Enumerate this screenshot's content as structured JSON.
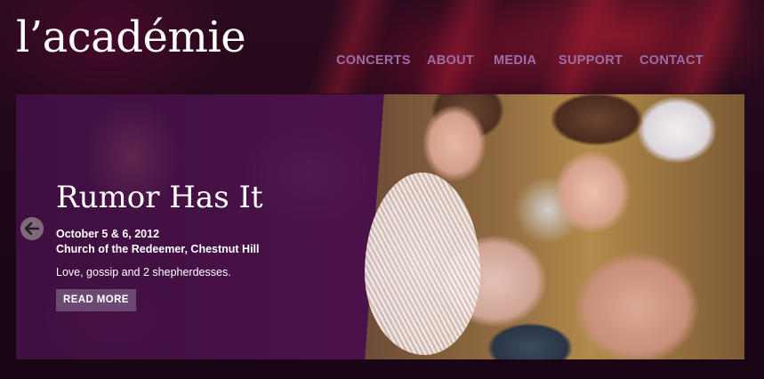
{
  "site": {
    "logo_text": "l’académie"
  },
  "nav": {
    "items": [
      {
        "label": "CONCERTS"
      },
      {
        "label": "ABOUT"
      },
      {
        "label": "MEDIA"
      },
      {
        "label": "SUPPORT"
      },
      {
        "label": "CONTACT"
      }
    ]
  },
  "hero": {
    "title": "Rumor Has It",
    "date": "October 5 & 6, 2012",
    "venue": "Church of the Redeemer, Chestnut Hill",
    "description": "Love, gossip and 2 shepherdesses.",
    "button_label": "READ MORE",
    "prev_icon": "arrow-left-icon"
  },
  "colors": {
    "nav_text": "#9c6fa8",
    "button_bg": "#6a4a72",
    "hero_bg": "#4a1249",
    "page_bg": "#1e0616"
  }
}
